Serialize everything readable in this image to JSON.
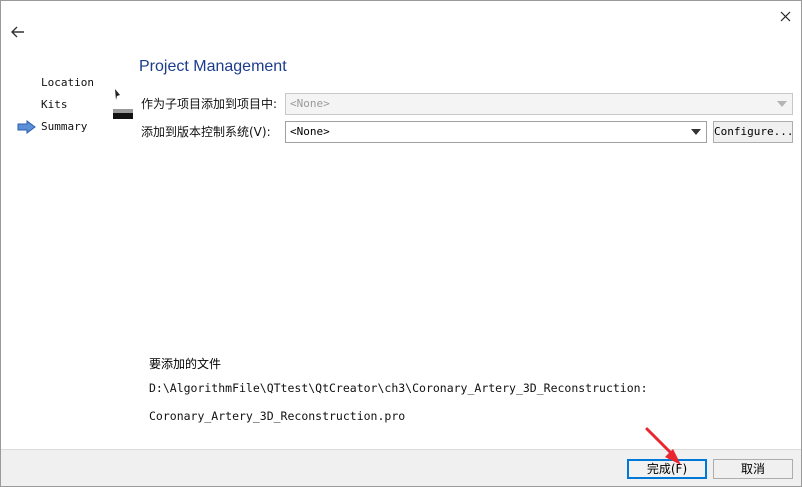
{
  "icons": {
    "back": "back-arrow-icon",
    "close": "close-icon",
    "current_step": "right-arrow-icon",
    "dropdown": "chevron-down-icon"
  },
  "nav": {
    "items": [
      {
        "label": "Location",
        "current": false
      },
      {
        "label": "Kits",
        "current": false
      },
      {
        "label": "Summary",
        "current": true
      }
    ]
  },
  "page": {
    "title": "Project Management"
  },
  "form": {
    "add_to_project_label": "作为子项目添加到项目中:",
    "add_to_project_value": "<None>",
    "vcs_label": "添加到版本控制系统(V):",
    "vcs_value": "<None>",
    "configure_label": "Configure..."
  },
  "files": {
    "title": "要添加的文件",
    "path": "D:\\AlgorithmFile\\QTtest\\QtCreator\\ch3\\Coronary_Artery_3D_Reconstruction:",
    "file": "Coronary_Artery_3D_Reconstruction.pro"
  },
  "footer": {
    "finish_label": "完成(F)",
    "cancel_label": "取消"
  },
  "colors": {
    "title": "#1c3d8c",
    "primary_border": "#0078d7",
    "annotation_arrow": "#e8262d",
    "footer_bg": "#f0f0f0"
  }
}
